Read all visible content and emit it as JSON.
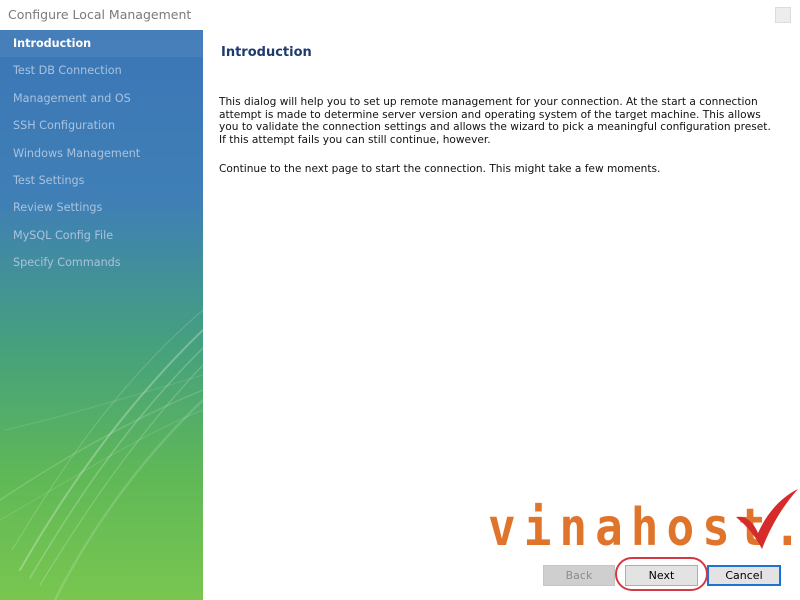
{
  "window": {
    "title": "Configure Local Management"
  },
  "sidebar": {
    "items": [
      {
        "label": "Introduction",
        "active": true
      },
      {
        "label": "Test DB Connection",
        "active": false
      },
      {
        "label": "Management and OS",
        "active": false
      },
      {
        "label": "SSH Configuration",
        "active": false
      },
      {
        "label": "Windows Management",
        "active": false
      },
      {
        "label": "Test Settings",
        "active": false
      },
      {
        "label": "Review Settings",
        "active": false
      },
      {
        "label": "MySQL Config File",
        "active": false
      },
      {
        "label": "Specify Commands",
        "active": false
      }
    ]
  },
  "main": {
    "heading": "Introduction",
    "paragraphs": [
      "This dialog will help you to set up remote management for your connection. At the start a connection attempt is made to determine server version and operating system of the target machine. This allows you to validate the connection settings and allows the wizard to pick a meaningful configuration preset. If this attempt fails you can still continue, however.",
      "Continue to the next page to start the connection. This might take a few moments."
    ]
  },
  "buttons": {
    "back": "Back",
    "next": "Next",
    "cancel": "Cancel",
    "back_enabled": false
  },
  "watermark": {
    "text": "vinahost."
  },
  "colors": {
    "accent_heading": "#1f3b6e",
    "focus_border": "#1e73d2",
    "highlight": "#d33a44",
    "watermark": "#e0742a"
  }
}
